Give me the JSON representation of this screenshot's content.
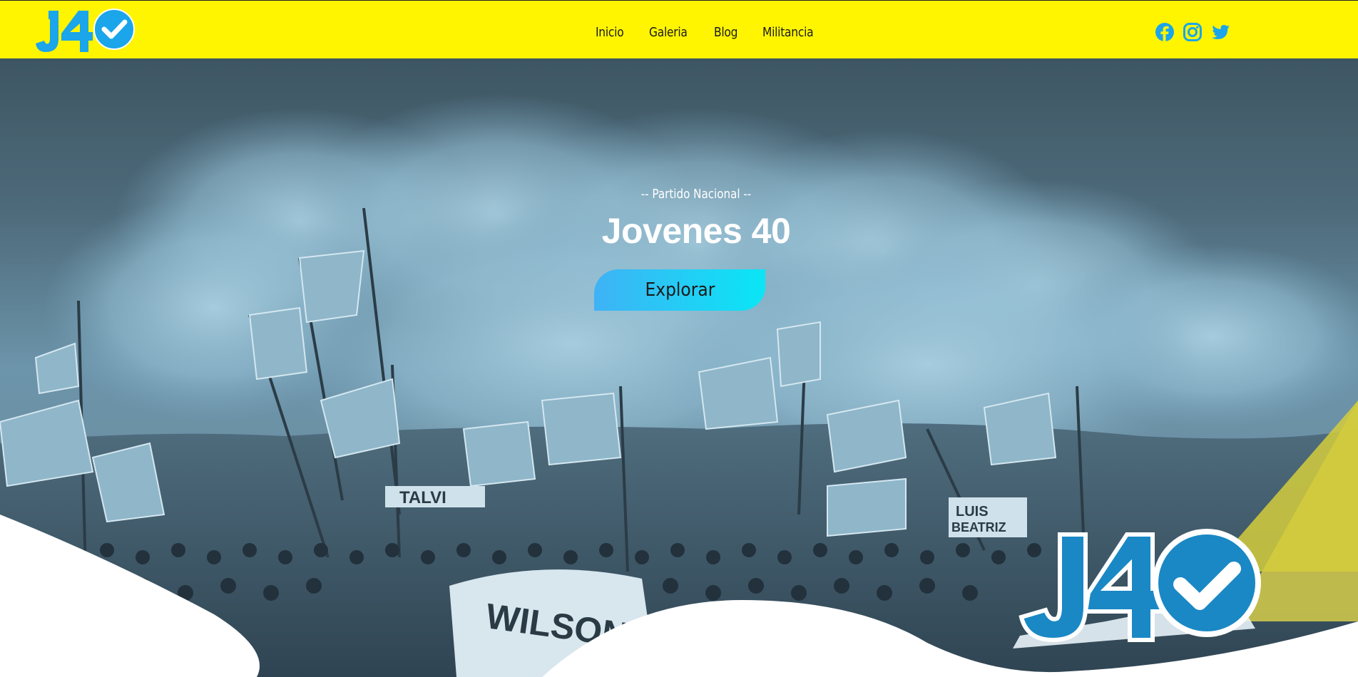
{
  "header": {
    "logo_text": "J40",
    "nav": [
      {
        "label": "Inicio"
      },
      {
        "label": "Galeria"
      },
      {
        "label": "Blog"
      },
      {
        "label": "Militancia"
      }
    ],
    "social": [
      {
        "icon": "facebook-icon"
      },
      {
        "icon": "instagram-icon"
      },
      {
        "icon": "twitter-icon"
      }
    ]
  },
  "hero": {
    "subtitle": "-- Partido Nacional --",
    "title": "Jovenes 40",
    "button_label": "Explorar",
    "badge_logo_text": "J40",
    "banner_texts": [
      "WILSON",
      "TALVI",
      "LUIS BEATRIZ"
    ]
  },
  "colors": {
    "navbar": "#fff500",
    "accent": "#1ba5ea",
    "button_gradient_start": "#3fb2f5",
    "button_gradient_end": "#0ae6f5",
    "hero_tint": "#4e6b7b"
  }
}
